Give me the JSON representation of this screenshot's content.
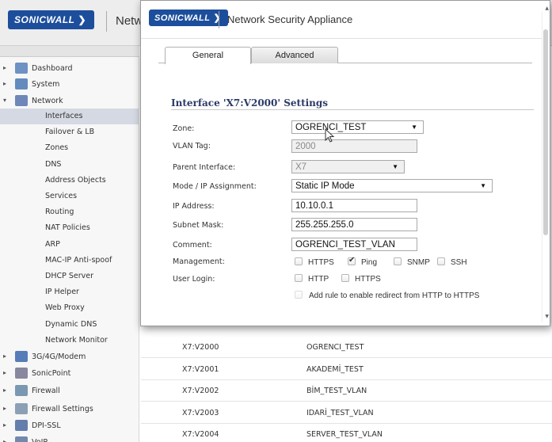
{
  "app": {
    "logo": "SONICWALL",
    "header_title": "Netw"
  },
  "sidebar": {
    "items": [
      {
        "label": "Dashboard",
        "icon": "dashboard-icon",
        "arrow": "▸"
      },
      {
        "label": "System",
        "icon": "monitor-icon",
        "arrow": "▸"
      },
      {
        "label": "Network",
        "icon": "network-globe-icon",
        "arrow": "▾"
      },
      {
        "label": "3G/4G/Modem",
        "icon": "modem-icon",
        "arrow": "▸"
      },
      {
        "label": "SonicPoint",
        "icon": "access-point-icon",
        "arrow": "▸"
      },
      {
        "label": "Firewall",
        "icon": "firewall-icon",
        "arrow": "▸"
      },
      {
        "label": "Firewall Settings",
        "icon": "firewall-settings-icon",
        "arrow": "▸"
      },
      {
        "label": "DPI-SSL",
        "icon": "dpi-ssl-icon",
        "arrow": "▸"
      },
      {
        "label": "VoIP",
        "icon": "voip-icon",
        "arrow": "▸"
      }
    ],
    "subitems": [
      "Interfaces",
      "Failover & LB",
      "Zones",
      "DNS",
      "Address Objects",
      "Services",
      "Routing",
      "NAT Policies",
      "ARP",
      "MAC-IP Anti-spoof",
      "DHCP Server",
      "IP Helper",
      "Web Proxy",
      "Dynamic DNS",
      "Network Monitor"
    ]
  },
  "table": {
    "rows": [
      {
        "name": "X7:V2000",
        "zone": "OGRENCI_TEST"
      },
      {
        "name": "X7:V2001",
        "zone": "AKADEMİ_TEST"
      },
      {
        "name": "X7:V2002",
        "zone": "BİM_TEST_VLAN"
      },
      {
        "name": "X7:V2003",
        "zone": "IDARİ_TEST_VLAN"
      },
      {
        "name": "X7:V2004",
        "zone": "SERVER_TEST_VLAN"
      }
    ]
  },
  "modal": {
    "logo": "SONICWALL",
    "title": "Network Security Appliance",
    "tabs": [
      {
        "label": "General",
        "active": true
      },
      {
        "label": "Advanced",
        "active": false
      }
    ],
    "section_title": "Interface 'X7:V2000' Settings",
    "fields": {
      "zone": {
        "label": "Zone:",
        "value": "OGRENCI_TEST"
      },
      "vlan_tag": {
        "label": "VLAN Tag:",
        "value": "2000"
      },
      "parent_interface": {
        "label": "Parent Interface:",
        "value": "X7"
      },
      "mode": {
        "label": "Mode / IP Assignment:",
        "value": "Static IP Mode"
      },
      "ip_address": {
        "label": "IP Address:",
        "value": "10.10.0.1"
      },
      "subnet_mask": {
        "label": "Subnet Mask:",
        "value": "255.255.255.0"
      },
      "comment": {
        "label": "Comment:",
        "value": "OGRENCI_TEST_VLAN"
      }
    },
    "management": {
      "label": "Management:",
      "options": [
        {
          "label": "HTTPS",
          "checked": false
        },
        {
          "label": "Ping",
          "checked": true
        },
        {
          "label": "SNMP",
          "checked": false
        },
        {
          "label": "SSH",
          "checked": false
        }
      ]
    },
    "user_login": {
      "label": "User Login:",
      "options": [
        {
          "label": "HTTP",
          "checked": false
        },
        {
          "label": "HTTPS",
          "checked": false
        }
      ]
    },
    "redirect": {
      "label": "Add rule to enable redirect from HTTP to HTTPS",
      "checked": false
    }
  },
  "colors": {
    "logo_bg": "#1c4e9c",
    "section_title": "#2b3a67",
    "active_nav": "#d5d9e3"
  }
}
